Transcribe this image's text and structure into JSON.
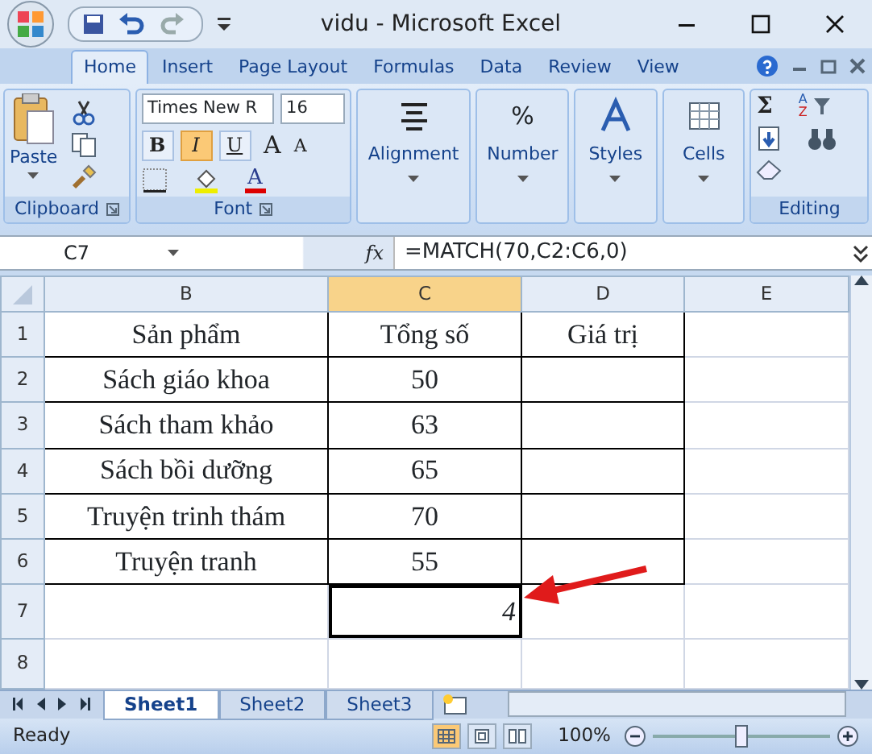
{
  "window": {
    "title": "vidu - Microsoft Excel"
  },
  "tabs": [
    {
      "label": "Home",
      "selected": true
    },
    {
      "label": "Insert",
      "selected": false
    },
    {
      "label": "Page Layout",
      "selected": false
    },
    {
      "label": "Formulas",
      "selected": false
    },
    {
      "label": "Data",
      "selected": false
    },
    {
      "label": "Review",
      "selected": false
    },
    {
      "label": "View",
      "selected": false
    }
  ],
  "ribbon": {
    "clipboard": {
      "label": "Clipboard",
      "paste": "Paste"
    },
    "font": {
      "label": "Font",
      "font_name": "Times New R",
      "font_size": "16",
      "styles": [
        {
          "kind": "bold",
          "label": "B",
          "on": false
        },
        {
          "kind": "italic",
          "label": "I",
          "on": true
        },
        {
          "kind": "underline",
          "label": "U",
          "on": false
        }
      ],
      "grow": "A",
      "shrink": "A",
      "font_color_glyph": "A"
    },
    "groups": [
      {
        "label": "Alignment",
        "kind": "align"
      },
      {
        "label": "Number",
        "kind": "percent",
        "glyph": "%"
      },
      {
        "label": "Styles",
        "kind": "styles"
      },
      {
        "label": "Cells",
        "kind": "cells"
      }
    ],
    "editing": {
      "label": "Editing",
      "sum": "Σ",
      "sort_a": "A",
      "sort_z": "Z"
    }
  },
  "name_box": "C7",
  "fx": "fx",
  "formula": "=MATCH(70,C2:C6,0)",
  "columns": [
    {
      "label": "B",
      "selected": false
    },
    {
      "label": "C",
      "selected": true
    },
    {
      "label": "D",
      "selected": false
    },
    {
      "label": "E",
      "selected": false
    }
  ],
  "rows": [
    {
      "label": "1",
      "cells": [
        "Sản phẩm",
        "Tổng số",
        "Giá trị",
        ""
      ]
    },
    {
      "label": "2",
      "cells": [
        "Sách giáo khoa",
        "50",
        "",
        ""
      ]
    },
    {
      "label": "3",
      "cells": [
        "Sách tham khảo",
        "63",
        "",
        ""
      ]
    },
    {
      "label": "4",
      "cells": [
        "Sách bồi dưỡng",
        "65",
        "",
        ""
      ]
    },
    {
      "label": "5",
      "cells": [
        "Truyện trinh thám",
        "70",
        "",
        ""
      ]
    },
    {
      "label": "6",
      "cells": [
        "Truyện tranh",
        "55",
        "",
        ""
      ]
    },
    {
      "label": "7",
      "cells": [
        "",
        {
          "text": "4",
          "selected": true
        },
        "",
        ""
      ]
    },
    {
      "label": "8",
      "cells": [
        "",
        "",
        "",
        ""
      ]
    }
  ],
  "sheets": [
    {
      "label": "Sheet1",
      "selected": true
    },
    {
      "label": "Sheet2",
      "selected": false
    },
    {
      "label": "Sheet3",
      "selected": false
    }
  ],
  "status_bar": {
    "status": "Ready",
    "zoom": "100%",
    "level": 0.5,
    "views": [
      {
        "kind": "normal",
        "selected": true
      },
      {
        "kind": "layout",
        "selected": false
      },
      {
        "kind": "break",
        "selected": false
      }
    ]
  }
}
